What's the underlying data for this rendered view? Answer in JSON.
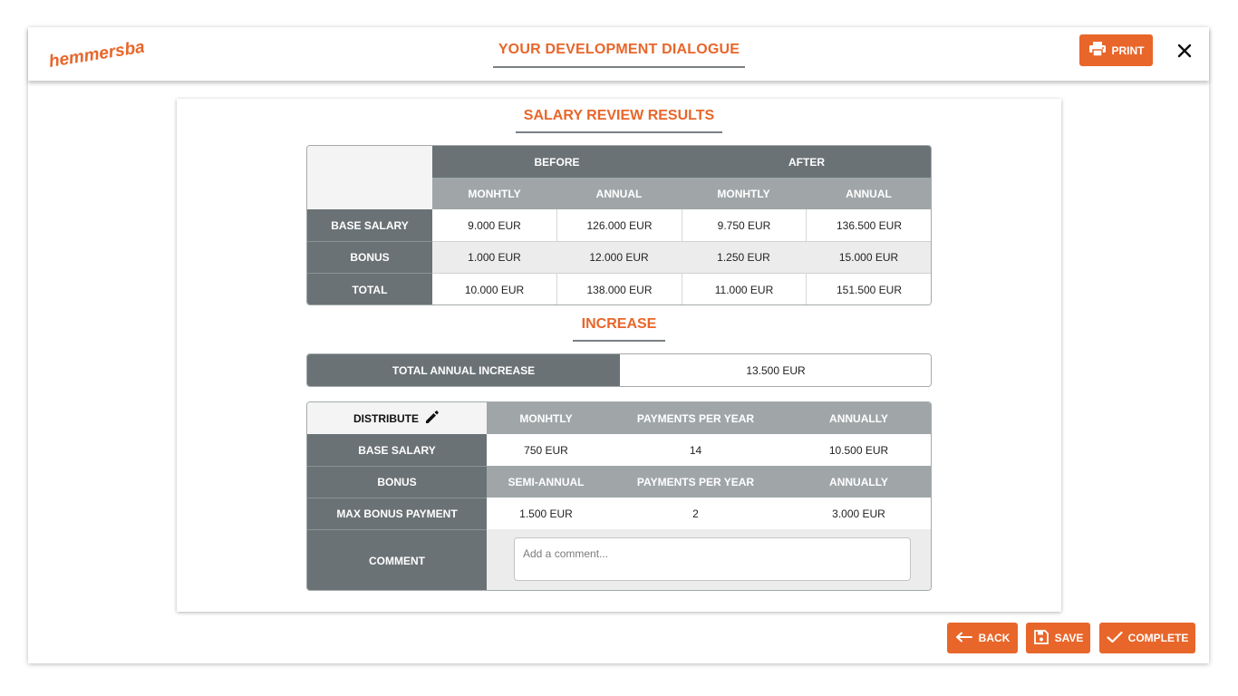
{
  "header": {
    "logo_text": "hemmersbach",
    "title": "YOUR DEVELOPMENT DIALOGUE",
    "print_label": "PRINT"
  },
  "salary_review": {
    "title": "SALARY REVIEW RESULTS",
    "group_before": "BEFORE",
    "group_after": "AFTER",
    "sub_headers": [
      "MONHTLY",
      "ANNUAL",
      "MONHTLY",
      "ANNUAL"
    ],
    "rows": [
      {
        "label": "BASE SALARY",
        "values": [
          "9.000 EUR",
          "126.000 EUR",
          "9.750 EUR",
          "136.500 EUR"
        ]
      },
      {
        "label": "BONUS",
        "values": [
          "1.000 EUR",
          "12.000 EUR",
          "1.250 EUR",
          "15.000 EUR"
        ]
      },
      {
        "label": "TOTAL",
        "values": [
          "10.000 EUR",
          "138.000 EUR",
          "11.000 EUR",
          "151.500 EUR"
        ]
      }
    ]
  },
  "increase": {
    "title": "INCREASE",
    "total_label": "TOTAL ANNUAL INCREASE",
    "total_value": "13.500 EUR"
  },
  "distribute": {
    "label": "DISTRIBUTE",
    "headers": [
      "MONHTLY",
      "PAYMENTS PER YEAR",
      "ANNUALLY"
    ],
    "base_salary": {
      "label": "BASE SALARY",
      "values": [
        "750 EUR",
        "14",
        "10.500 EUR"
      ]
    },
    "bonus_headers": {
      "label": "BONUS",
      "values": [
        "SEMI-ANNUAL",
        "PAYMENTS PER YEAR",
        "ANNUALLY"
      ]
    },
    "max_bonus": {
      "label": "MAX BONUS PAYMENT",
      "values": [
        "1.500 EUR",
        "2",
        "3.000 EUR"
      ]
    },
    "comment_label": "COMMENT",
    "comment_placeholder": "Add a comment..."
  },
  "actions": {
    "back_label": "BACK",
    "save_label": "SAVE",
    "complete_label": "COMPLETE"
  },
  "colors": {
    "accent": "#e8662a",
    "header_dark": "#6a7275",
    "header_mid": "#a0a6a8"
  }
}
